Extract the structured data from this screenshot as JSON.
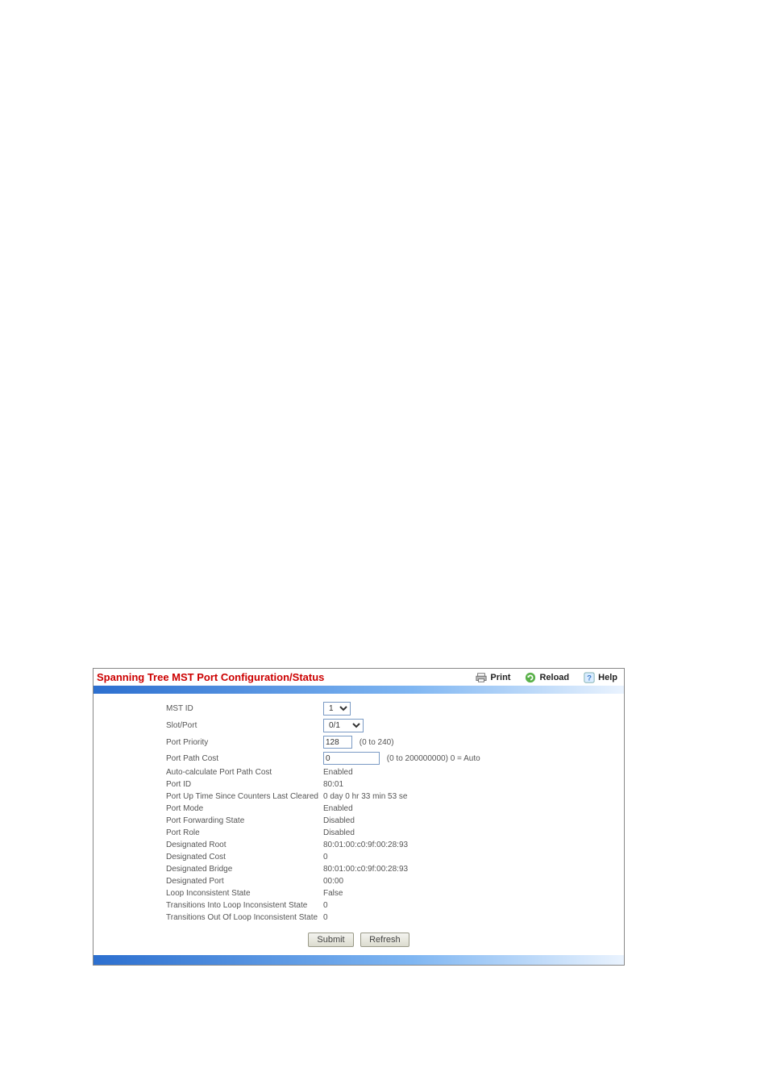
{
  "title": "Spanning Tree MST Port Configuration/Status",
  "actions": {
    "print": "Print",
    "reload": "Reload",
    "help": "Help"
  },
  "fields": {
    "mst_id": {
      "label": "MST ID",
      "value": "1"
    },
    "slot_port": {
      "label": "Slot/Port",
      "value": "0/1"
    },
    "port_priority": {
      "label": "Port Priority",
      "value": "128",
      "hint": "(0 to 240)"
    },
    "port_path_cost": {
      "label": "Port Path Cost",
      "value": "0",
      "hint": "(0 to 200000000) 0 = Auto"
    },
    "auto_calc": {
      "label": "Auto-calculate Port Path Cost",
      "value": "Enabled"
    },
    "port_id": {
      "label": "Port ID",
      "value": "80:01"
    },
    "uptime": {
      "label": "Port Up Time Since Counters Last Cleared",
      "value": "0 day 0 hr 33 min 53 se"
    },
    "port_mode": {
      "label": "Port Mode",
      "value": "Enabled"
    },
    "fwd_state": {
      "label": "Port Forwarding State",
      "value": "Disabled"
    },
    "port_role": {
      "label": "Port Role",
      "value": "Disabled"
    },
    "des_root": {
      "label": "Designated Root",
      "value": "80:01:00:c0:9f:00:28:93"
    },
    "des_cost": {
      "label": "Designated Cost",
      "value": "0"
    },
    "des_bridge": {
      "label": "Designated Bridge",
      "value": "80:01:00:c0:9f:00:28:93"
    },
    "des_port": {
      "label": "Designated Port",
      "value": "00:00"
    },
    "loop_state": {
      "label": "Loop Inconsistent State",
      "value": "False"
    },
    "trans_into": {
      "label": "Transitions Into Loop Inconsistent State",
      "value": "0"
    },
    "trans_out": {
      "label": "Transitions Out Of Loop Inconsistent State",
      "value": "0"
    }
  },
  "buttons": {
    "submit": "Submit",
    "refresh": "Refresh"
  }
}
